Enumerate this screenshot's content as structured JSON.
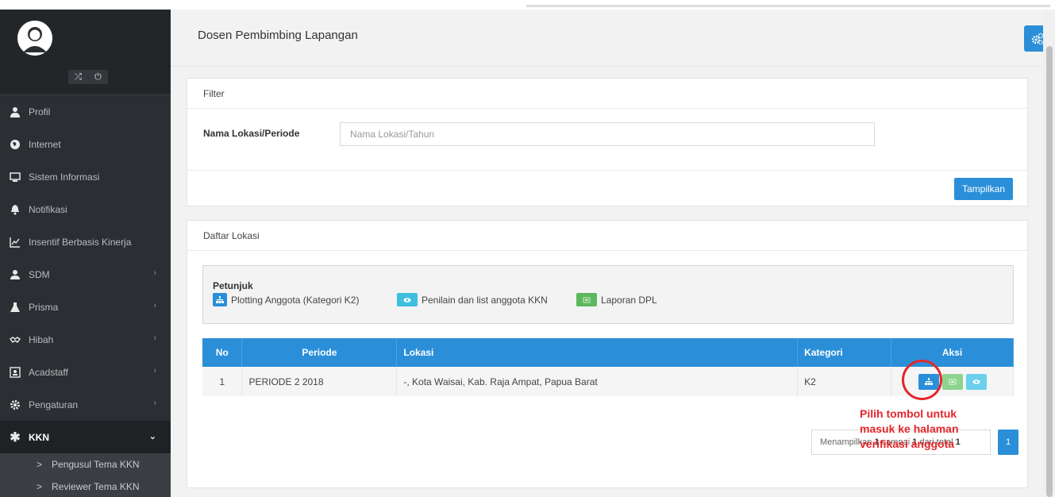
{
  "page": {
    "title": "Dosen Pembimbing Lapangan"
  },
  "sidebar": {
    "items": [
      {
        "label": "Profil",
        "icon": "user-tie-icon"
      },
      {
        "label": "Internet",
        "icon": "globe-icon"
      },
      {
        "label": "Sistem Informasi",
        "icon": "desktop-icon"
      },
      {
        "label": "Notifikasi",
        "icon": "bell-icon"
      },
      {
        "label": "Insentif Berbasis Kinerja",
        "icon": "line-chart-icon"
      },
      {
        "label": "SDM",
        "icon": "user-icon",
        "chevron": "›"
      },
      {
        "label": "Prisma",
        "icon": "flask-icon",
        "chevron": "›"
      },
      {
        "label": "Hibah",
        "icon": "handshake-icon",
        "chevron": "›"
      },
      {
        "label": "Acadstaff",
        "icon": "id-card-icon",
        "chevron": "›"
      },
      {
        "label": "Pengaturan",
        "icon": "cog-icon",
        "chevron": "›"
      },
      {
        "label": "KKN",
        "icon": "asterisk-icon",
        "chevron": "⌄"
      }
    ],
    "subitems": [
      {
        "label": "Pengusul Tema KKN"
      },
      {
        "label": "Reviewer Tema KKN"
      }
    ],
    "gt": ">"
  },
  "filter": {
    "title": "Filter",
    "label": "Nama Lokasi/Periode",
    "placeholder": "Nama Lokasi/Tahun",
    "button": "Tampilkan"
  },
  "lokasi": {
    "title": "Daftar Lokasi",
    "petunjuk": {
      "title": "Petunjuk",
      "items": [
        {
          "label": "Plotting Anggota (Kategori K2)",
          "color": "#2a8fd8",
          "icon": "sitemap-icon"
        },
        {
          "label": "Penilain dan list anggota KKN",
          "color": "#3fbfe0",
          "icon": "eye-icon"
        },
        {
          "label": "Laporan DPL",
          "color": "#5cb85c",
          "icon": "report-icon"
        }
      ]
    },
    "table": {
      "headers": [
        "No",
        "Periode",
        "Lokasi",
        "Kategori",
        "Aksi"
      ],
      "rows": [
        {
          "no": "1",
          "periode": "PERIODE 2 2018",
          "lokasi": "-, Kota Waisai, Kab. Raja Ampat, Papua Barat",
          "kategori": "K2"
        }
      ]
    },
    "pager": {
      "prefix": "Menampilkan ",
      "from": "1",
      "mid": " sampai ",
      "to": "1",
      "mid2": " dari total ",
      "total": "1",
      "page": "1"
    }
  },
  "annotation": {
    "text": "Pilih tombol untuk masuk ke halaman verifikasi anggota"
  }
}
